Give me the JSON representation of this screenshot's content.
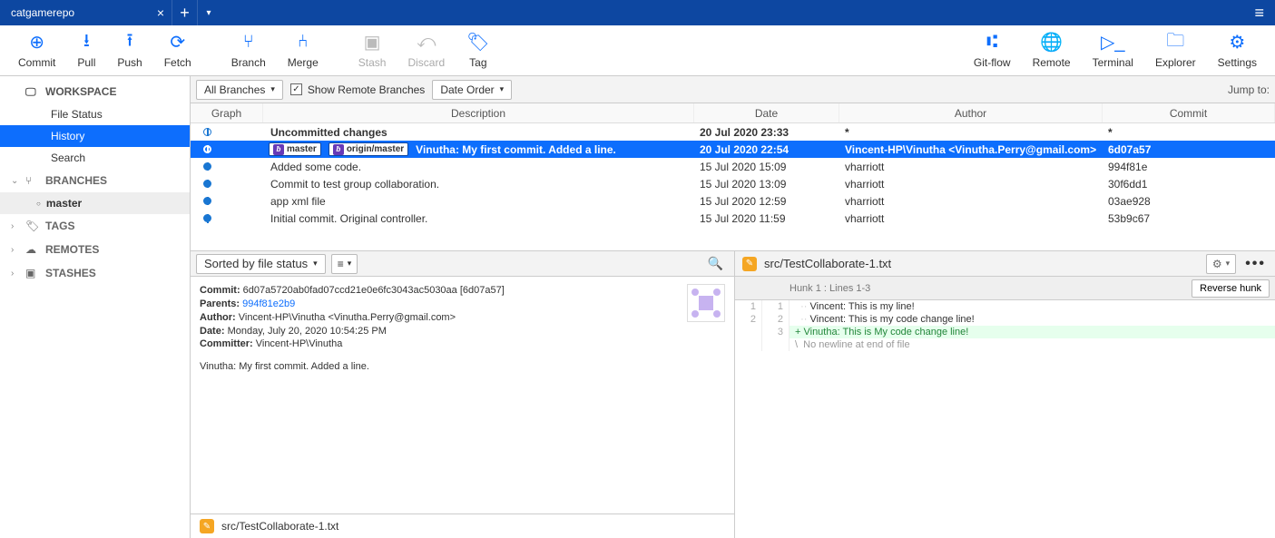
{
  "titlebar": {
    "tab_label": "catgamerepo"
  },
  "toolbar": {
    "left": [
      {
        "id": "commit",
        "label": "Commit",
        "disabled": false
      },
      {
        "id": "pull",
        "label": "Pull",
        "disabled": false
      },
      {
        "id": "push",
        "label": "Push",
        "disabled": false
      },
      {
        "id": "fetch",
        "label": "Fetch",
        "disabled": false
      },
      {
        "id": "branch",
        "label": "Branch",
        "disabled": false
      },
      {
        "id": "merge",
        "label": "Merge",
        "disabled": false
      },
      {
        "id": "stash",
        "label": "Stash",
        "disabled": true
      },
      {
        "id": "discard",
        "label": "Discard",
        "disabled": true
      },
      {
        "id": "tag",
        "label": "Tag",
        "disabled": false
      }
    ],
    "right": [
      {
        "id": "gitflow",
        "label": "Git-flow"
      },
      {
        "id": "remote",
        "label": "Remote"
      },
      {
        "id": "terminal",
        "label": "Terminal"
      },
      {
        "id": "explorer",
        "label": "Explorer"
      },
      {
        "id": "settings",
        "label": "Settings"
      }
    ]
  },
  "sidebar": {
    "workspace": {
      "label": "WORKSPACE",
      "items": [
        "File Status",
        "History",
        "Search"
      ],
      "selected": "History"
    },
    "branches": {
      "label": "BRANCHES",
      "items": [
        "master"
      ],
      "active": "master"
    },
    "tags": {
      "label": "TAGS"
    },
    "remotes": {
      "label": "REMOTES"
    },
    "stashes": {
      "label": "STASHES"
    }
  },
  "filter": {
    "branches_dd": "All Branches",
    "show_remote": "Show Remote Branches",
    "order_dd": "Date Order",
    "jump": "Jump to:"
  },
  "table": {
    "headers": {
      "graph": "Graph",
      "desc": "Description",
      "date": "Date",
      "author": "Author",
      "commit": "Commit"
    },
    "rows": [
      {
        "desc": "Uncommitted changes",
        "date": "20 Jul 2020 23:33",
        "author": "*",
        "commit": "*",
        "node": "hollow",
        "sel": false,
        "bold": true
      },
      {
        "desc": "Vinutha: My first commit. Added a line.",
        "date": "20 Jul 2020 22:54",
        "author": "Vincent-HP\\Vinutha <Vinutha.Perry@gmail.com>",
        "commit": "6d07a57",
        "node": "sel",
        "sel": true,
        "bold": true,
        "tags": {
          "local": "master",
          "remote": "origin/master"
        }
      },
      {
        "desc": "Added some code.",
        "date": "15 Jul 2020 15:09",
        "author": "vharriott",
        "commit": "994f81e",
        "node": "dot",
        "sel": false
      },
      {
        "desc": "Commit to test group collaboration.",
        "date": "15 Jul 2020 13:09",
        "author": "vharriott",
        "commit": "30f6dd1",
        "node": "dot",
        "sel": false
      },
      {
        "desc": "app xml file",
        "date": "15 Jul 2020 12:59",
        "author": "vharriott",
        "commit": "03ae928",
        "node": "dot",
        "sel": false
      },
      {
        "desc": "Initial commit. Original controller.",
        "date": "15 Jul 2020 11:59",
        "author": "vharriott",
        "commit": "53b9c67",
        "node": "dot-last",
        "sel": false
      }
    ]
  },
  "details": {
    "sort_dd": "Sorted by file status",
    "commit_label": "Commit:",
    "commit_full": "6d07a5720ab0fad07ccd21e0e6fc3043ac5030aa [6d07a57]",
    "parents_label": "Parents:",
    "parents_link": "994f81e2b9",
    "author_label": "Author:",
    "author_val": "Vincent-HP\\Vinutha <Vinutha.Perry@gmail.com>",
    "date_label": "Date:",
    "date_val": "Monday, July 20, 2020 10:54:25 PM",
    "committer_label": "Committer:",
    "committer_val": "Vincent-HP\\Vinutha",
    "message": "Vinutha: My first commit. Added a line.",
    "file": "src/TestCollaborate-1.txt"
  },
  "diff": {
    "file": "src/TestCollaborate-1.txt",
    "hunk": "Hunk 1 : Lines 1-3",
    "reverse": "Reverse hunk",
    "lines": [
      {
        "old": "1",
        "new": "1",
        "t": "ctx",
        "txt": "Vincent: This is my line!"
      },
      {
        "old": "2",
        "new": "2",
        "t": "ctx",
        "txt": "Vincent: This is my code change line!"
      },
      {
        "old": "",
        "new": "3",
        "t": "add",
        "txt": "Vinutha: This is My code change line!"
      },
      {
        "old": "",
        "new": "",
        "t": "meta",
        "txt": "No newline at end of file"
      }
    ]
  }
}
